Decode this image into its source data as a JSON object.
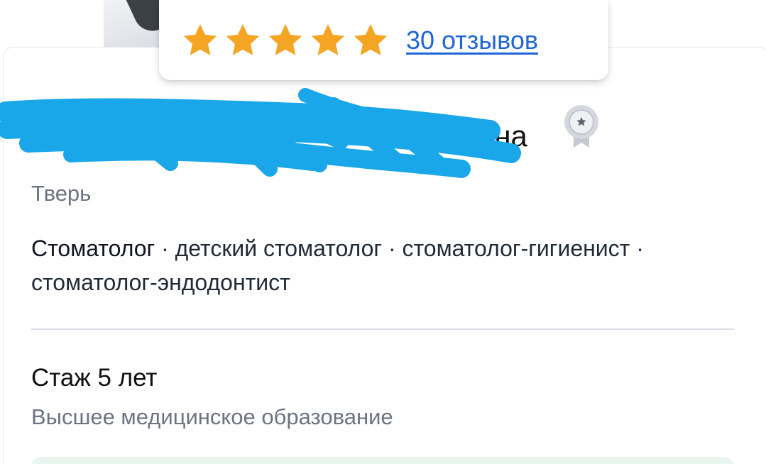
{
  "rating": {
    "stars": 5,
    "max_stars": 5,
    "reviews_link": "30 отзывов",
    "star_color": "#f5a524"
  },
  "doctor": {
    "name_visible_tail": "вна",
    "award_badge_icon": "medal-icon",
    "city": "Тверь",
    "primary_specialty": "Стоматолог",
    "other_specialties": " · детский стоматолог · стоматолог-гигиенист · стоматолог-эндодонтист",
    "experience": "Стаж 5 лет",
    "education": "Высшее медицинское образование"
  },
  "colors": {
    "link": "#1f66d6",
    "muted": "#6d7382",
    "scribble": "#1aa7ea",
    "info_block": "#e8f6ef"
  }
}
